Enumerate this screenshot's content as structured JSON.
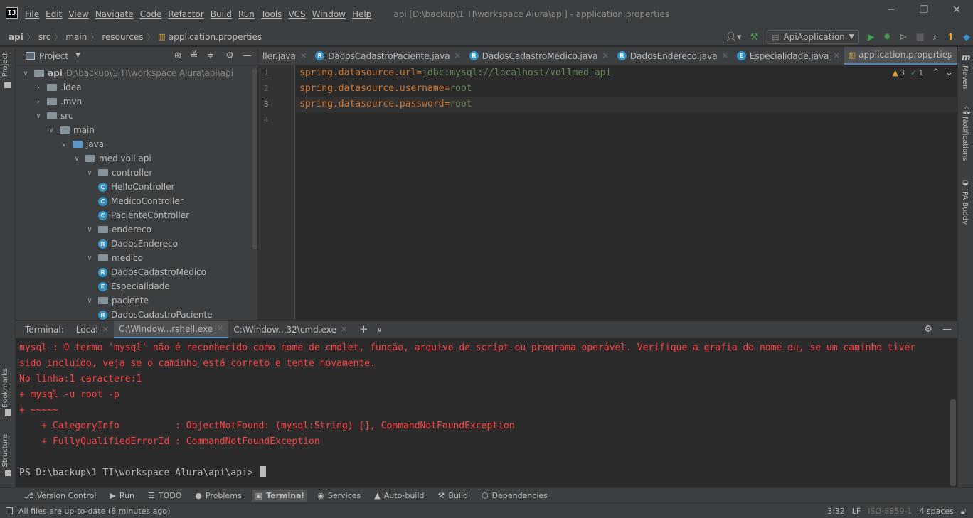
{
  "titlebar": {
    "menu": [
      "File",
      "Edit",
      "View",
      "Navigate",
      "Code",
      "Refactor",
      "Build",
      "Run",
      "Tools",
      "VCS",
      "Window",
      "Help"
    ],
    "title": "api [D:\\backup\\1 TI\\workspace Alura\\api] - application.properties",
    "logo": "IJ"
  },
  "navbar": {
    "breadcrumbs": [
      "api",
      "src",
      "main",
      "resources",
      "application.properties"
    ],
    "run_config": "ApiApplication"
  },
  "left_stripe": {
    "project_tab": "Project",
    "bookmarks_tab": "Bookmarks",
    "structure_tab": "Structure"
  },
  "right_stripe": {
    "maven_tab": "Maven",
    "notifications_tab": "Notifications",
    "jpa_tab": "JPA Buddy"
  },
  "project": {
    "header": "Project",
    "root_name": "api",
    "root_path": "D:\\backup\\1 TI\\workspace Alura\\api\\api",
    "tree": [
      {
        "label": ".idea",
        "depth": 1,
        "kind": "folder",
        "expanded": false
      },
      {
        "label": ".mvn",
        "depth": 1,
        "kind": "folder",
        "expanded": false
      },
      {
        "label": "src",
        "depth": 1,
        "kind": "folder",
        "expanded": true
      },
      {
        "label": "main",
        "depth": 2,
        "kind": "folder",
        "expanded": true
      },
      {
        "label": "java",
        "depth": 3,
        "kind": "folder-blue",
        "expanded": true
      },
      {
        "label": "med.voll.api",
        "depth": 4,
        "kind": "package",
        "expanded": true
      },
      {
        "label": "controller",
        "depth": 5,
        "kind": "package",
        "expanded": true
      },
      {
        "label": "HelloController",
        "depth": 6,
        "kind": "class"
      },
      {
        "label": "MedicoController",
        "depth": 6,
        "kind": "class"
      },
      {
        "label": "PacienteController",
        "depth": 6,
        "kind": "class"
      },
      {
        "label": "endereco",
        "depth": 5,
        "kind": "package",
        "expanded": true
      },
      {
        "label": "DadosEndereco",
        "depth": 6,
        "kind": "record"
      },
      {
        "label": "medico",
        "depth": 5,
        "kind": "package",
        "expanded": true
      },
      {
        "label": "DadosCadastroMedico",
        "depth": 6,
        "kind": "record"
      },
      {
        "label": "Especialidade",
        "depth": 6,
        "kind": "enum"
      },
      {
        "label": "paciente",
        "depth": 5,
        "kind": "package",
        "expanded": true
      },
      {
        "label": "DadosCadastroPaciente",
        "depth": 6,
        "kind": "record"
      }
    ]
  },
  "editor_tabs": [
    {
      "label": "ller.java",
      "icon": "",
      "active": false
    },
    {
      "label": "DadosCadastroPaciente.java",
      "icon": "R",
      "active": false
    },
    {
      "label": "DadosCadastroMedico.java",
      "icon": "R",
      "active": false
    },
    {
      "label": "DadosEndereco.java",
      "icon": "R",
      "active": false
    },
    {
      "label": "Especialidade.java",
      "icon": "E",
      "active": false
    },
    {
      "label": "application.properties",
      "icon": "props",
      "active": true
    }
  ],
  "editor": {
    "line_numbers": [
      "1",
      "2",
      "3",
      "4"
    ],
    "current_line": 3,
    "lines": [
      {
        "key": "spring.datasource.url",
        "value": "jdbc:mysql://localhost/vollmed_api"
      },
      {
        "key": "spring.datasource.username",
        "value": "root"
      },
      {
        "key": "spring.datasource.password",
        "value": "root"
      },
      {
        "key": "",
        "value": ""
      }
    ],
    "warnings": "3",
    "ok_count": "1"
  },
  "terminal": {
    "label": "Terminal:",
    "tabs": [
      {
        "label": "Local",
        "active": false
      },
      {
        "label": "C:\\Window...rshell.exe",
        "active": true
      },
      {
        "label": "C:\\Window...32\\cmd.exe",
        "active": false
      }
    ],
    "error_lines": [
      "mysql : O termo 'mysql' não é reconhecido como nome de cmdlet, função, arquivo de script ou programa operável. Verifique a grafia do nome ou, se um caminho tiver",
      "sido incluído, veja se o caminho está correto e tente novamente.",
      "No linha:1 caractere:1",
      "+ mysql -u root -p",
      "+ ~~~~~",
      "    + CategoryInfo          : ObjectNotFound: (mysql:String) [], CommandNotFoundException",
      "    + FullyQualifiedErrorId : CommandNotFoundException",
      ""
    ],
    "prompt": "PS D:\\backup\\1 TI\\workspace Alura\\api\\api> "
  },
  "tool_windows": [
    {
      "label": "Version Control",
      "icon": "⎇",
      "active": false
    },
    {
      "label": "Run",
      "icon": "▶",
      "active": false
    },
    {
      "label": "TODO",
      "icon": "☰",
      "active": false
    },
    {
      "label": "Problems",
      "icon": "●",
      "active": false
    },
    {
      "label": "Terminal",
      "icon": "▣",
      "active": true
    },
    {
      "label": "Services",
      "icon": "◉",
      "active": false
    },
    {
      "label": "Auto-build",
      "icon": "▲",
      "active": false
    },
    {
      "label": "Build",
      "icon": "⚒",
      "active": false
    },
    {
      "label": "Dependencies",
      "icon": "⬡",
      "active": false
    }
  ],
  "statusbar": {
    "message": "All files are up-to-date (8 minutes ago)",
    "position": "3:32",
    "line_sep": "LF",
    "encoding": "ISO-8859-1",
    "indent": "4 spaces"
  },
  "colors": {
    "accent": "#4a88c7",
    "error_text": "#ff4141",
    "prop_key": "#cc7832",
    "prop_value": "#6a8759"
  }
}
